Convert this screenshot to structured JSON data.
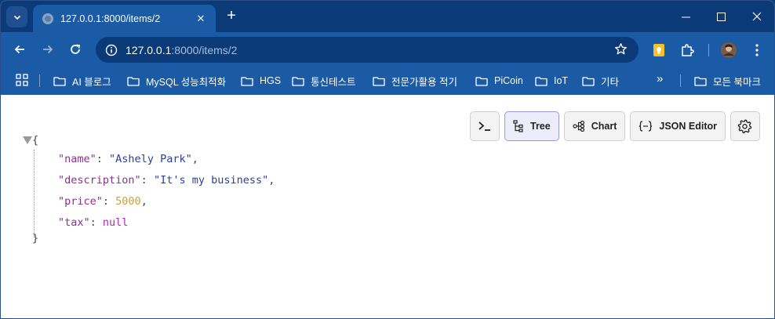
{
  "browser": {
    "tab_title": "127.0.0.1:8000/items/2",
    "address_host": "127.0.0.1",
    "address_path": ":8000/items/2",
    "accent": "#1b5aa5",
    "frame": "#0b3a78"
  },
  "bookmarks": [
    {
      "label": "AI 블로그"
    },
    {
      "label": "MySQL 성능최적화"
    },
    {
      "label": "HGS"
    },
    {
      "label": "통신테스트"
    },
    {
      "label": "전문가활용 적기"
    },
    {
      "label": "PiCoin"
    },
    {
      "label": "IoT"
    },
    {
      "label": "기타"
    }
  ],
  "bookmarks_all": "모든 북마크",
  "viewer": {
    "tree_label": "Tree",
    "chart_label": "Chart",
    "editor_label": "JSON Editor"
  },
  "json": {
    "open": "{",
    "close": "}",
    "rows": [
      {
        "key": "\"name\"",
        "value": "\"Ashely Park\"",
        "type": "string",
        "tail": ","
      },
      {
        "key": "\"description\"",
        "value": "\"It's my business\"",
        "type": "string",
        "tail": ","
      },
      {
        "key": "\"price\"",
        "value": "5000",
        "type": "number",
        "tail": ","
      },
      {
        "key": "\"tax\"",
        "value": "null",
        "type": "null",
        "tail": ""
      }
    ]
  }
}
